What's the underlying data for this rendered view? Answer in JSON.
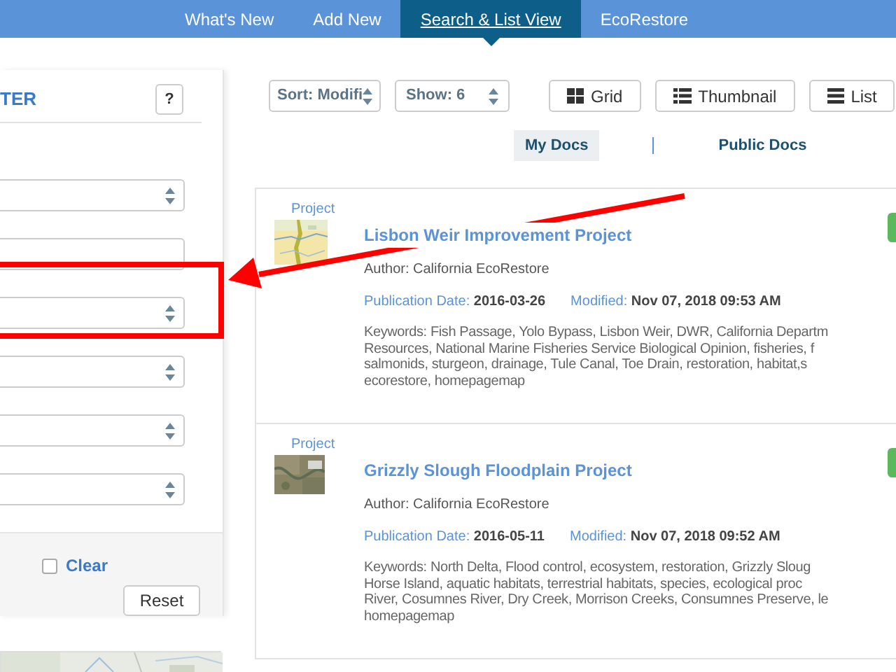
{
  "nav": {
    "tabs": [
      {
        "label": "What's New",
        "selected": false
      },
      {
        "label": "Add New",
        "selected": false
      },
      {
        "label": "Search & List View",
        "selected": true
      },
      {
        "label": "EcoRestore",
        "selected": false
      }
    ]
  },
  "filter": {
    "title": "TER",
    "help": "?",
    "fields": [
      {
        "kind": "select"
      },
      {
        "kind": "input"
      },
      {
        "kind": "select"
      },
      {
        "kind": "select"
      },
      {
        "kind": "select"
      },
      {
        "kind": "select"
      }
    ],
    "clear": {
      "label": "Clear",
      "checked": false
    },
    "reset": "Reset"
  },
  "toolbar": {
    "sort": "Sort: Modifi",
    "show": "Show: 6",
    "views": [
      {
        "kind": "grid",
        "label": "Grid"
      },
      {
        "kind": "thumbnail",
        "label": "Thumbnail"
      },
      {
        "kind": "list",
        "label": "List"
      }
    ]
  },
  "doc_tabs": [
    {
      "label": "My Docs",
      "selected": true
    },
    {
      "label": "Public Docs",
      "selected": false
    }
  ],
  "results": [
    {
      "type": "Project",
      "title": "Lisbon Weir Improvement Project",
      "author": "Author: California EcoRestore",
      "pub_label": "Publication Date:",
      "pub_date": "2016-03-26",
      "mod_label": "Modified:",
      "modified": "Nov 07, 2018 09:53 AM",
      "keywords": [
        "Keywords: Fish Passage, Yolo Bypass, Lisbon Weir, DWR, California Departm",
        "Resources, National Marine Fisheries Service Biological Opinion, fisheries, f",
        "salmonids, sturgeon, drainage, Tule Canal, Toe Drain, restoration, habitat,s",
        "ecorestore, homepagemap"
      ]
    },
    {
      "type": "Project",
      "title": "Grizzly Slough Floodplain Project",
      "author": "Author: California EcoRestore",
      "pub_label": "Publication Date:",
      "pub_date": "2016-05-11",
      "mod_label": "Modified:",
      "modified": "Nov 07, 2018 09:52 AM",
      "keywords": [
        "Keywords: North Delta, Flood control, ecosystem, restoration, Grizzly Sloug",
        "Horse Island, aquatic habitats, terrestrial habitats, species, ecological proc",
        "River, Cosumnes River, Dry Creek, Morrison Creeks, Consumnes Preserve, le",
        "homepagemap"
      ]
    }
  ]
}
